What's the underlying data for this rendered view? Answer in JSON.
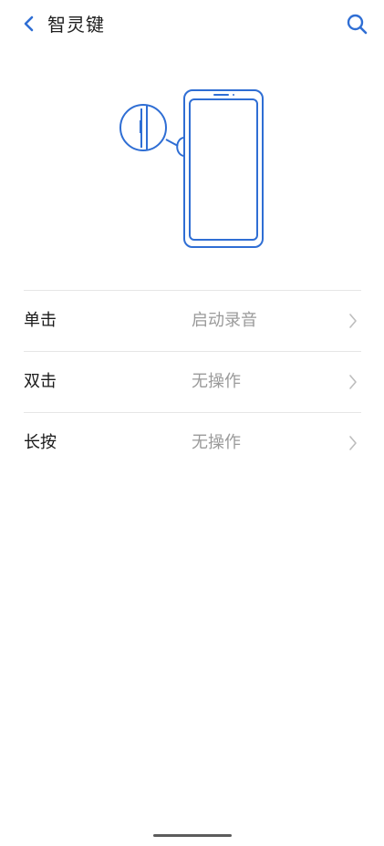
{
  "header": {
    "title": "智灵键",
    "back_icon": "chevron-left-icon",
    "search_icon": "search-icon"
  },
  "colors": {
    "accent": "#2f6ed4",
    "divider": "#e6e6e6",
    "secondary_text": "#9a9a9a"
  },
  "settings": [
    {
      "label": "单击",
      "value": "启动录音"
    },
    {
      "label": "双击",
      "value": "无操作"
    },
    {
      "label": "长按",
      "value": "无操作"
    }
  ]
}
